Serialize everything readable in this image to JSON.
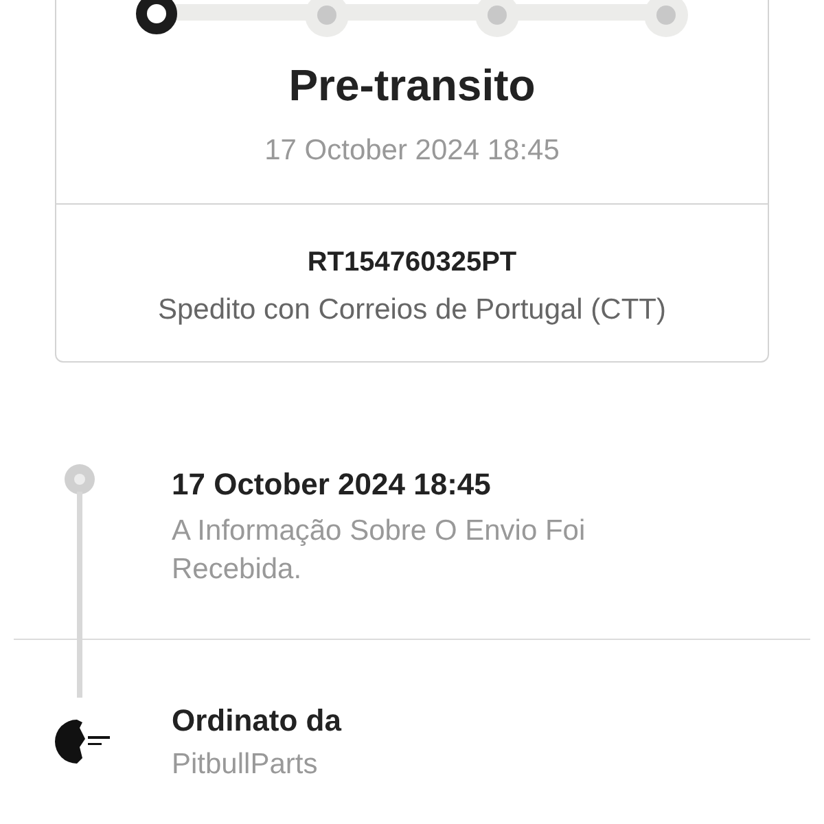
{
  "progress": {
    "steps": [
      {
        "selected": true
      },
      {
        "selected": false
      },
      {
        "selected": false
      },
      {
        "selected": false
      }
    ]
  },
  "status": {
    "title": "Pre-transito",
    "date": "17 October 2024 18:45"
  },
  "shipment": {
    "tracking_number": "RT154760325PT",
    "carrier": "Spedito con Correios de Portugal (CTT)"
  },
  "events": [
    {
      "kind": "dot",
      "date": "17 October 2024 18:45",
      "description": "A Informação Sobre O Envio Foi Recebida."
    },
    {
      "kind": "logo",
      "title": "Ordinato da",
      "store": "PitbullParts"
    }
  ]
}
